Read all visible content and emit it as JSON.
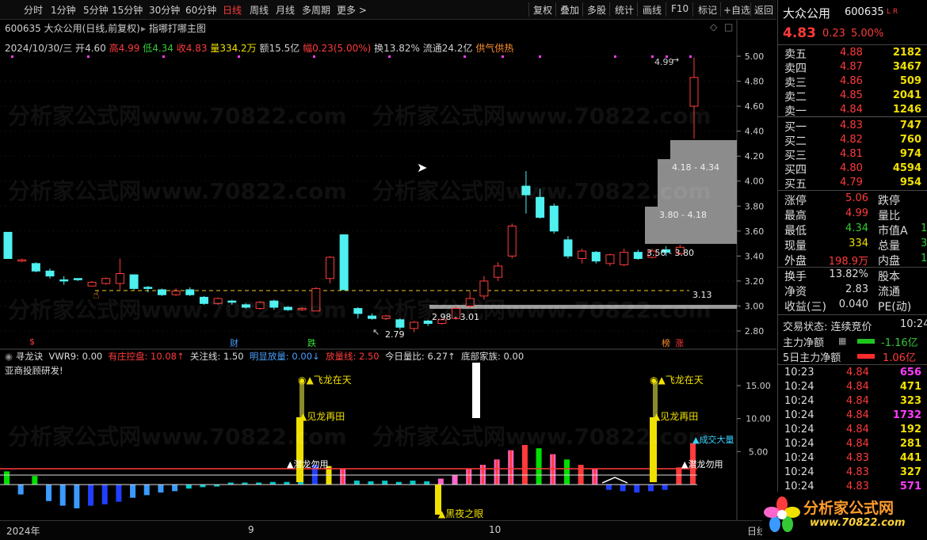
{
  "toolbar": {
    "left": [
      "分时",
      "1分钟",
      "5分钟",
      "15分钟",
      "30分钟",
      "60分钟",
      "日线",
      "周线",
      "月线",
      "多周期",
      "更多 >"
    ],
    "active": "日线",
    "right": [
      "复权",
      "叠加",
      "多股",
      "统计",
      "画线",
      "F10",
      "标记",
      "+自选",
      "返回"
    ]
  },
  "main": {
    "stock_line": "600635 大众公用(日线,前复权)",
    "indicator_selector": "指哪打哪主图",
    "date": "2024/10/30/三",
    "open_label": "开",
    "open": "4.60",
    "high_label": "高",
    "high": "4.99",
    "low_label": "低",
    "low": "4.34",
    "close_label": "收",
    "close": "4.83",
    "vol_label": "量",
    "vol": "334.2万",
    "amount_label": "额",
    "amount": "15.5亿",
    "range_label": "幅",
    "range": "0.23(5.00%)",
    "turnover_label": "换",
    "turnover": "13.82%",
    "float_label": "流通",
    "float": "24.2亿",
    "note": "供气供热",
    "price_axis": [
      "5.00",
      "4.80",
      "4.60",
      "4.40",
      "4.20",
      "4.00",
      "3.80",
      "3.60",
      "3.40",
      "3.20",
      "3.00",
      "2.80"
    ],
    "annotations": {
      "high": "4.99",
      "low": "2.79",
      "zone1": "4.18 - 4.34",
      "zone2": "3.80 - 4.18",
      "zone3": "3.50 - 3.80",
      "zone4": "2.98 - 3.01",
      "dash": "3.13"
    },
    "markers": {
      "s": "$",
      "cai": "财",
      "die": "跌",
      "bang": "榜",
      "zhang": "涨"
    }
  },
  "sub": {
    "name": "寻龙诀",
    "vwr": "VWR9: 0.00",
    "zhuang": "有庄控盘: 10.08↑",
    "guanzhu": "关注线: 1.50",
    "mingxian": "明显放量: 0.00↓",
    "fangliang": "放量线: 2.50",
    "liangbi": "今日量比: 6.27↑",
    "dibu": "底部家族: 0.00",
    "author": "亚商投顾研发!",
    "axis": [
      "15.00",
      "10.00",
      "5.00"
    ],
    "labels": {
      "feilong1": "飞龙在天",
      "jianlong1": "见龙再田",
      "qianlong1": "潜龙勿用",
      "heiye": "黑夜之眼",
      "feilong2": "飞龙在天",
      "jianlong2": "见龙再田",
      "chengjiao": "成交大量",
      "qianlong2": "潜龙勿用"
    }
  },
  "time_axis": [
    "2024年",
    "9",
    "10"
  ],
  "time_axis_right": "日线",
  "watermark": "分析家公式网www.70822.com",
  "logo": {
    "title": "分析家公式网",
    "url": "www.70822.com"
  },
  "quote": {
    "name": "大众公用",
    "code": "600635",
    "tags": "L R",
    "price": "4.83",
    "change": "0.23",
    "pct": "5.00%",
    "asks": [
      {
        "label": "卖五",
        "price": "4.88",
        "vol": "2182"
      },
      {
        "label": "卖四",
        "price": "4.87",
        "vol": "3467"
      },
      {
        "label": "卖三",
        "price": "4.86",
        "vol": "509"
      },
      {
        "label": "卖二",
        "price": "4.85",
        "vol": "2041"
      },
      {
        "label": "卖一",
        "price": "4.84",
        "vol": "1246"
      }
    ],
    "bids": [
      {
        "label": "买一",
        "price": "4.83",
        "vol": "747"
      },
      {
        "label": "买二",
        "price": "4.82",
        "vol": "760"
      },
      {
        "label": "买三",
        "price": "4.81",
        "vol": "974"
      },
      {
        "label": "买四",
        "price": "4.80",
        "vol": "4594"
      },
      {
        "label": "买五",
        "price": "4.79",
        "vol": "954"
      }
    ],
    "stats": [
      {
        "l1": "涨停",
        "v1": "5.06",
        "c1": "#ff3b3b",
        "l2": "跌停",
        "v2": ""
      },
      {
        "l1": "最高",
        "v1": "4.99",
        "c1": "#ff3b3b",
        "l2": "量比",
        "v2": ""
      },
      {
        "l1": "最低",
        "v1": "4.34",
        "c1": "#34c934",
        "l2": "市值A",
        "v2": "1"
      },
      {
        "l1": "现量",
        "v1": "334",
        "c1": "#f0e000",
        "l2": "总量",
        "v2": "3"
      },
      {
        "l1": "外盘",
        "v1": "198.9万",
        "c1": "#ff3b3b",
        "l2": "内盘",
        "v2": "1"
      }
    ],
    "stats2": [
      {
        "l1": "换手",
        "v1": "13.82%",
        "l2": "股本"
      },
      {
        "l1": "净资",
        "v1": "2.83",
        "l2": "流通"
      },
      {
        "l1": "收益(三)",
        "v1": "0.040",
        "l2": "PE(动)"
      }
    ],
    "trade_status": "交易状态: 连续竞价",
    "trade_time": "10:24",
    "main_flow_label": "主力净额",
    "main_flow": "-1.16亿",
    "main5_label": "5日主力净额",
    "main5": "1.06亿",
    "ticks": [
      {
        "t": "10:23",
        "p": "4.84",
        "v": "656",
        "c": "#ff3bff"
      },
      {
        "t": "10:24",
        "p": "4.84",
        "v": "471",
        "c": "#f0e000"
      },
      {
        "t": "10:24",
        "p": "4.84",
        "v": "323",
        "c": "#f0e000"
      },
      {
        "t": "10:24",
        "p": "4.84",
        "v": "1732",
        "c": "#ff3bff"
      },
      {
        "t": "10:24",
        "p": "4.84",
        "v": "192",
        "c": "#f0e000"
      },
      {
        "t": "10:24",
        "p": "4.84",
        "v": "281",
        "c": "#f0e000"
      },
      {
        "t": "10:24",
        "p": "4.83",
        "v": "441",
        "c": "#f0e000"
      },
      {
        "t": "10:24",
        "p": "4.83",
        "v": "327",
        "c": "#f0e000"
      },
      {
        "t": "10:24",
        "p": "4.83",
        "v": "571",
        "c": "#ff3bff"
      }
    ]
  },
  "candles": [
    {
      "o": 3.59,
      "c": 3.38,
      "h": 3.59,
      "l": 3.38
    },
    {
      "o": 3.36,
      "c": 3.37,
      "h": 3.38,
      "l": 3.35
    },
    {
      "o": 3.34,
      "c": 3.28,
      "h": 3.35,
      "l": 3.27
    },
    {
      "o": 3.28,
      "c": 3.24,
      "h": 3.3,
      "l": 3.22
    },
    {
      "o": 3.21,
      "c": 3.2,
      "h": 3.24,
      "l": 3.17
    },
    {
      "o": 3.22,
      "c": 3.21,
      "h": 3.22,
      "l": 3.2
    },
    {
      "o": 3.16,
      "c": 3.19,
      "h": 3.2,
      "l": 3.16
    },
    {
      "o": 3.18,
      "c": 3.22,
      "h": 3.23,
      "l": 3.17
    },
    {
      "o": 3.18,
      "c": 3.26,
      "h": 3.38,
      "l": 3.13
    },
    {
      "o": 3.25,
      "c": 3.14,
      "h": 3.25,
      "l": 3.13
    },
    {
      "o": 3.15,
      "c": 3.14,
      "h": 3.16,
      "l": 3.11
    },
    {
      "o": 3.13,
      "c": 3.09,
      "h": 3.14,
      "l": 3.08
    },
    {
      "o": 3.09,
      "c": 3.12,
      "h": 3.14,
      "l": 3.08
    },
    {
      "o": 3.13,
      "c": 3.09,
      "h": 3.15,
      "l": 3.08
    },
    {
      "o": 3.07,
      "c": 3.02,
      "h": 3.08,
      "l": 3.01
    },
    {
      "o": 3.02,
      "c": 3.06,
      "h": 3.07,
      "l": 3.01
    },
    {
      "o": 3.04,
      "c": 3.03,
      "h": 3.05,
      "l": 3.01
    },
    {
      "o": 3.01,
      "c": 2.99,
      "h": 3.02,
      "l": 2.98
    },
    {
      "o": 2.98,
      "c": 3.03,
      "h": 3.04,
      "l": 2.97
    },
    {
      "o": 3.04,
      "c": 2.99,
      "h": 3.05,
      "l": 2.97
    },
    {
      "o": 2.99,
      "c": 2.97,
      "h": 3.0,
      "l": 2.96
    },
    {
      "o": 2.97,
      "c": 2.98,
      "h": 2.99,
      "l": 2.96
    },
    {
      "o": 2.96,
      "c": 3.14,
      "h": 3.15,
      "l": 2.96
    },
    {
      "o": 3.22,
      "c": 3.39,
      "h": 3.4,
      "l": 3.18
    },
    {
      "o": 3.57,
      "c": 3.13,
      "h": 3.57,
      "l": 3.13
    },
    {
      "o": 2.98,
      "c": 2.94,
      "h": 2.99,
      "l": 2.9
    },
    {
      "o": 2.92,
      "c": 2.9,
      "h": 2.94,
      "l": 2.89
    },
    {
      "o": 2.9,
      "c": 2.92,
      "h": 2.93,
      "l": 2.89
    },
    {
      "o": 2.89,
      "c": 2.83,
      "h": 2.9,
      "l": 2.81
    },
    {
      "o": 2.82,
      "c": 2.87,
      "h": 2.88,
      "l": 2.79
    },
    {
      "o": 2.88,
      "c": 2.86,
      "h": 2.89,
      "l": 2.84
    },
    {
      "o": 2.86,
      "c": 2.89,
      "h": 2.9,
      "l": 2.85
    },
    {
      "o": 2.9,
      "c": 2.98,
      "h": 3.0,
      "l": 2.89
    },
    {
      "o": 3.0,
      "c": 3.06,
      "h": 3.12,
      "l": 2.98
    },
    {
      "o": 3.08,
      "c": 3.2,
      "h": 3.24,
      "l": 3.05
    },
    {
      "o": 3.23,
      "c": 3.32,
      "h": 3.35,
      "l": 3.2
    },
    {
      "o": 3.4,
      "c": 3.64,
      "h": 3.66,
      "l": 3.38
    },
    {
      "o": 3.96,
      "c": 3.89,
      "h": 4.08,
      "l": 3.74
    },
    {
      "o": 3.87,
      "c": 3.71,
      "h": 3.94,
      "l": 3.7
    },
    {
      "o": 3.8,
      "c": 3.6,
      "h": 3.82,
      "l": 3.58
    },
    {
      "o": 3.53,
      "c": 3.4,
      "h": 3.56,
      "l": 3.38
    },
    {
      "o": 3.38,
      "c": 3.44,
      "h": 3.46,
      "l": 3.34
    },
    {
      "o": 3.43,
      "c": 3.36,
      "h": 3.44,
      "l": 3.34
    },
    {
      "o": 3.34,
      "c": 3.41,
      "h": 3.42,
      "l": 3.32
    },
    {
      "o": 3.33,
      "c": 3.43,
      "h": 3.46,
      "l": 3.32
    },
    {
      "o": 3.43,
      "c": 3.38,
      "h": 3.45,
      "l": 3.37
    },
    {
      "o": 3.39,
      "c": 3.44,
      "h": 3.46,
      "l": 3.38
    },
    {
      "o": 3.45,
      "c": 3.43,
      "h": 3.48,
      "l": 3.4
    },
    {
      "o": 3.42,
      "c": 3.47,
      "h": 3.49,
      "l": 3.41
    },
    {
      "o": 4.6,
      "c": 4.83,
      "h": 4.99,
      "l": 4.34
    }
  ],
  "vol_bars": [
    {
      "v": 2.0,
      "c": "#00e000"
    },
    {
      "v": -1.5,
      "c": "#3a9aff"
    },
    {
      "v": 1.3,
      "c": "#00e000"
    },
    {
      "v": -2.5,
      "c": "#3a9aff"
    },
    {
      "v": -3.2,
      "c": "#3a9aff"
    },
    {
      "v": -3.6,
      "c": "#3a9aff"
    },
    {
      "v": -3.2,
      "c": "#1f3fff"
    },
    {
      "v": -3.0,
      "c": "#1f3fff"
    },
    {
      "v": -2.6,
      "c": "#1f3fff"
    },
    {
      "v": -2.0,
      "c": "#3a9aff"
    },
    {
      "v": -1.6,
      "c": "#3a9aff"
    },
    {
      "v": -1.2,
      "c": "#3a9aff"
    },
    {
      "v": -1.0,
      "c": "#3a9aff"
    },
    {
      "v": -0.6,
      "c": "#00c8c8"
    },
    {
      "v": -0.4,
      "c": "#00c8c8"
    },
    {
      "v": -0.3,
      "c": "#00c8c8"
    },
    {
      "v": 0.3,
      "c": "#00c8c8"
    },
    {
      "v": 0.3,
      "c": "#00c8c8"
    },
    {
      "v": 0.3,
      "c": "#00c8c8"
    },
    {
      "v": 0.4,
      "c": "#00c8c8"
    },
    {
      "v": 0.4,
      "c": "#00c8c8"
    },
    {
      "v": 0.6,
      "c": "#00c8c8"
    },
    {
      "v": 3.0,
      "c": "#1f3fff"
    },
    {
      "v": 2.8,
      "c": "#f0e000"
    },
    {
      "v": 2.4,
      "c": "#ff66cc"
    },
    {
      "v": 0.6,
      "c": "#00c8c8"
    },
    {
      "v": 0.5,
      "c": "#00c8c8"
    },
    {
      "v": 0.6,
      "c": "#00c8c8"
    },
    {
      "v": 0.4,
      "c": "#00c8c8"
    },
    {
      "v": 0.6,
      "c": "#00c8c8"
    },
    {
      "v": 0.5,
      "c": "#00c8c8"
    },
    {
      "v": 0.9,
      "c": "#ff66cc"
    },
    {
      "v": 1.4,
      "c": "#ff66cc"
    },
    {
      "v": 2.4,
      "c": "#ff66cc"
    },
    {
      "v": 3.0,
      "c": "#ff66cc"
    },
    {
      "v": 3.8,
      "c": "#ff66cc"
    },
    {
      "v": 5.2,
      "c": "#ff66cc"
    },
    {
      "v": 6.0,
      "c": "#ff3b3b"
    },
    {
      "v": 5.5,
      "c": "#00e000"
    },
    {
      "v": 4.6,
      "c": "#ff66cc"
    },
    {
      "v": 3.8,
      "c": "#00e000"
    },
    {
      "v": 3.0,
      "c": "#ff3b3b"
    },
    {
      "v": 2.4,
      "c": "#ff66cc"
    },
    {
      "v": -0.8,
      "c": "#1f3fff"
    },
    {
      "v": -1.0,
      "c": "#1f3fff"
    },
    {
      "v": -1.2,
      "c": "#1f3fff"
    },
    {
      "v": -1.0,
      "c": "#1f3fff"
    },
    {
      "v": -0.8,
      "c": "#1f3fff"
    },
    {
      "v": 2.6,
      "c": "#ff3b3b"
    },
    {
      "v": 6.27,
      "c": "#ff3b3b"
    }
  ]
}
